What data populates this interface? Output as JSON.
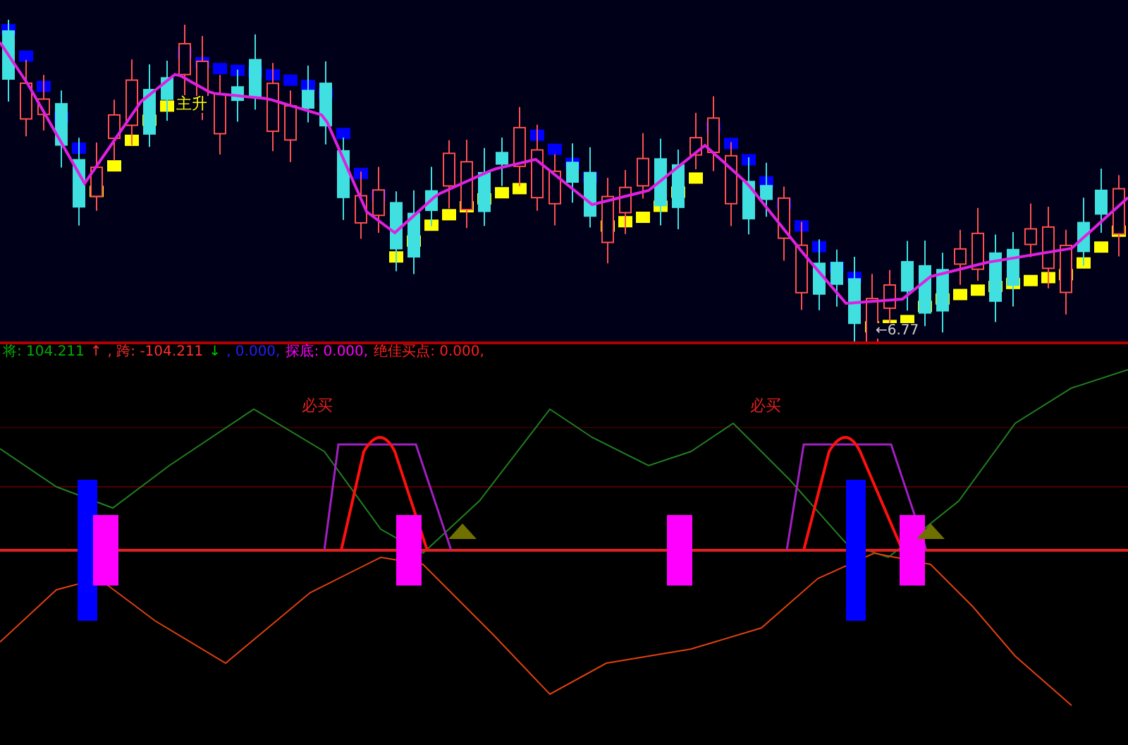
{
  "price_panel": {
    "trend_label": "主升",
    "low_marker": "←6.77"
  },
  "indicator_panel": {
    "legend": [
      {
        "text": "将: 104.211",
        "color": "#00b000"
      },
      {
        "text": "↑",
        "color": "#ff3030"
      },
      {
        "text": ", 跨: -104.211",
        "color": "#ff3030"
      },
      {
        "text": "↓",
        "color": "#00c000"
      },
      {
        "text": ", 0.000,",
        "color": "#2020ff"
      },
      {
        "text": "探底: 0.000,",
        "color": "#ff00ff"
      },
      {
        "text": "绝佳买点: 0.000,",
        "color": "#ff2020"
      }
    ],
    "signal_labels": [
      "必买",
      "必买"
    ]
  }
}
